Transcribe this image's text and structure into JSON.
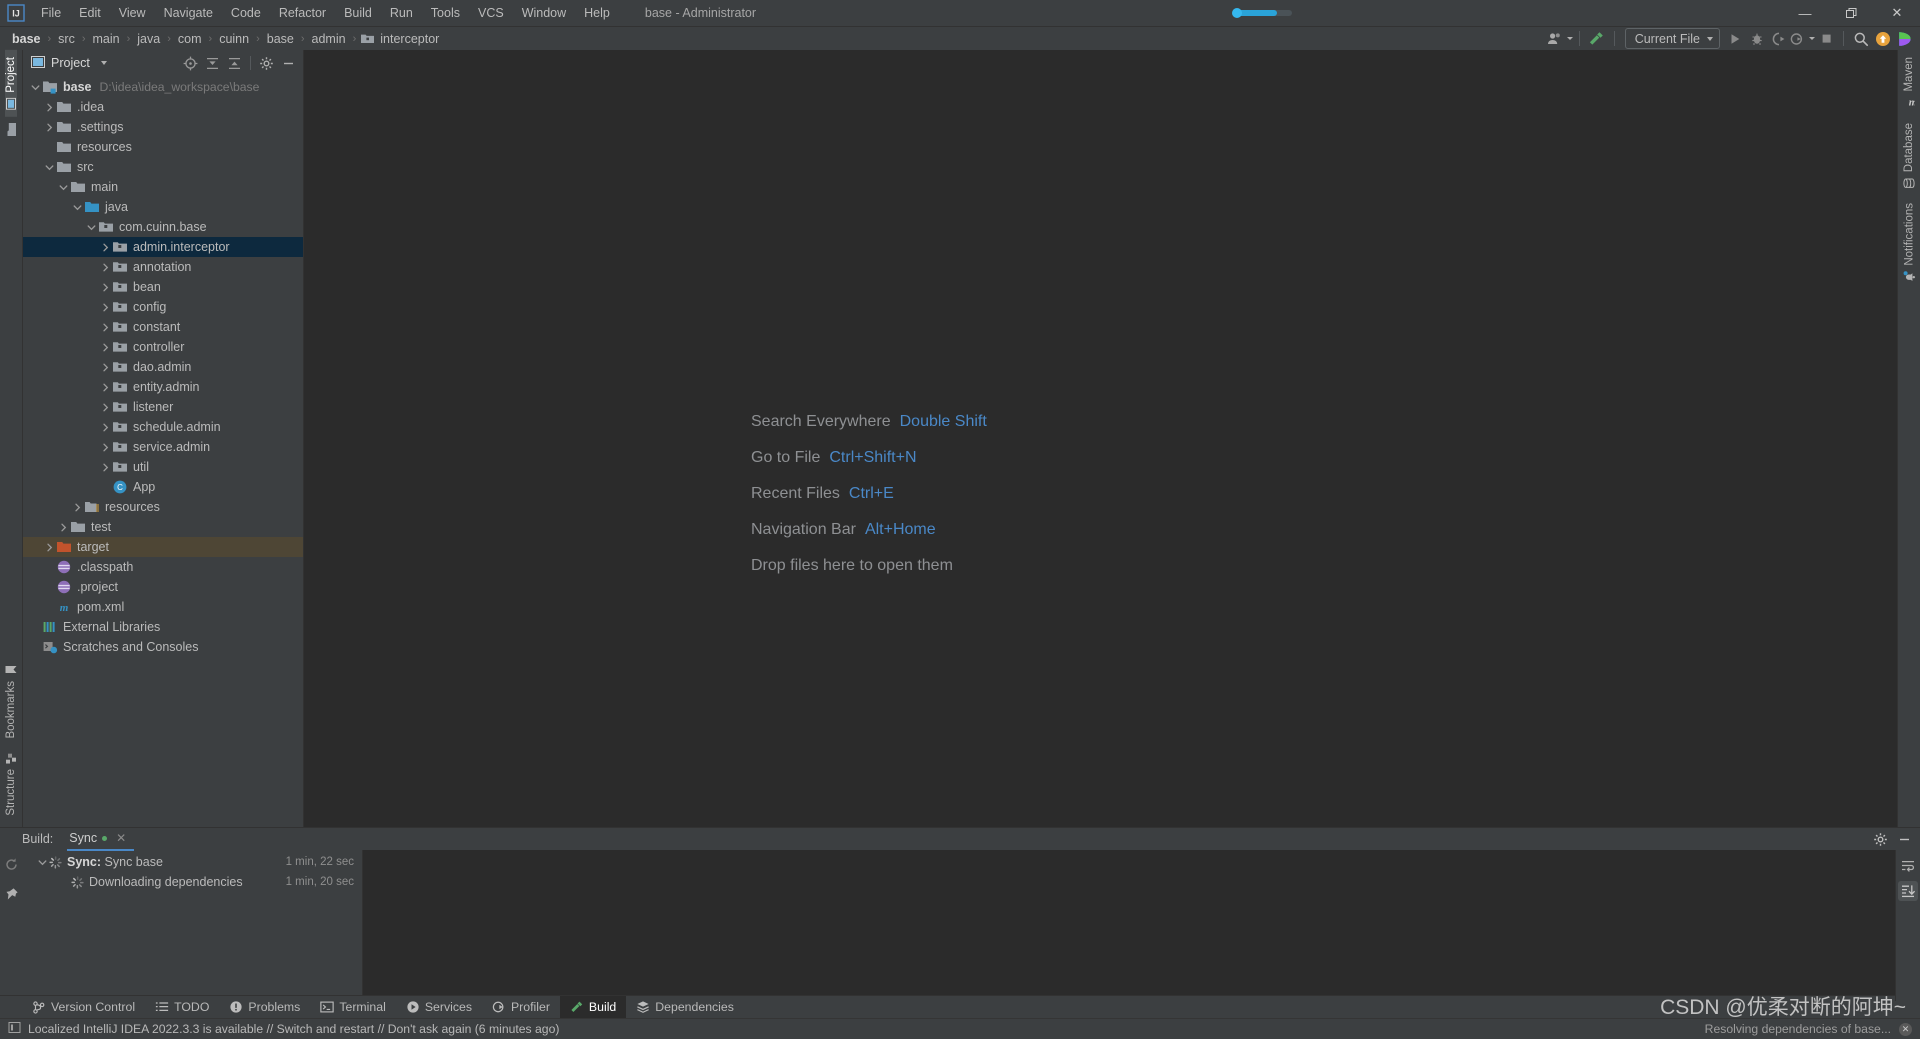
{
  "window": {
    "title": "base - Administrator",
    "logo_icon": "intellij-idea-logo",
    "minimize_label": "—",
    "maximize_label": "❐",
    "close_label": "✕"
  },
  "menu": {
    "items": [
      {
        "label": "File"
      },
      {
        "label": "Edit"
      },
      {
        "label": "View"
      },
      {
        "label": "Navigate"
      },
      {
        "label": "Code"
      },
      {
        "label": "Refactor"
      },
      {
        "label": "Build"
      },
      {
        "label": "Run"
      },
      {
        "label": "Tools"
      },
      {
        "label": "VCS"
      },
      {
        "label": "Window"
      },
      {
        "label": "Help"
      }
    ]
  },
  "navbar": {
    "crumbs": [
      {
        "label": "base",
        "icon": ""
      },
      {
        "label": "src",
        "icon": ""
      },
      {
        "label": "main",
        "icon": ""
      },
      {
        "label": "java",
        "icon": ""
      },
      {
        "label": "com",
        "icon": ""
      },
      {
        "label": "cuinn",
        "icon": ""
      },
      {
        "label": "base",
        "icon": ""
      },
      {
        "label": "admin",
        "icon": ""
      },
      {
        "label": "interceptor",
        "icon": "package-icon"
      }
    ],
    "separator": "›"
  },
  "toolbar": {
    "profile_icon": "user-profile-icon",
    "hammer_icon": "build-hammer-icon",
    "run_config": "Current File",
    "run_icon": "run-triangle-icon",
    "debug_icon": "debug-bug-icon",
    "coverage_icon": "run-with-coverage-icon",
    "profile_run_icon": "profiler-run-icon",
    "stop_icon": "stop-square-icon",
    "search_icon": "search-magnifier-icon",
    "update_icon": "update-available-icon",
    "feature_icon": "play-colored-icon"
  },
  "left_stripe": {
    "top": [
      {
        "label": "Project",
        "icon": "project-panel-icon",
        "active": true
      },
      {
        "label": "",
        "icon": "folder-icon",
        "active": false
      }
    ],
    "bottom": [
      {
        "label": "Bookmarks",
        "icon": "bookmark-icon"
      },
      {
        "label": "Structure",
        "icon": "structure-icon"
      }
    ]
  },
  "right_stripe": {
    "items": [
      {
        "label": "Maven",
        "icon": "maven-m-icon"
      },
      {
        "label": "Database",
        "icon": "database-icon"
      },
      {
        "label": "Notifications",
        "icon": "notifications-bell-icon"
      }
    ]
  },
  "project_panel": {
    "title": "Project",
    "tools": [
      {
        "name": "select-opened-file-icon"
      },
      {
        "name": "expand-all-icon"
      },
      {
        "name": "collapse-all-icon"
      },
      {
        "name": "settings-gear-icon"
      },
      {
        "name": "hide-panel-icon"
      }
    ],
    "tree": [
      {
        "depth": 0,
        "label": "base",
        "path": "D:\\idea\\idea_workspace\\base",
        "icon": "module-icon",
        "arrow": "down",
        "bold": true,
        "state": ""
      },
      {
        "depth": 1,
        "label": ".idea",
        "path": "",
        "icon": "folder-icon",
        "arrow": "right",
        "bold": false,
        "state": ""
      },
      {
        "depth": 1,
        "label": ".settings",
        "path": "",
        "icon": "folder-icon",
        "arrow": "right",
        "bold": false,
        "state": ""
      },
      {
        "depth": 1,
        "label": "resources",
        "path": "",
        "icon": "folder-icon",
        "arrow": "none",
        "bold": false,
        "state": ""
      },
      {
        "depth": 1,
        "label": "src",
        "path": "",
        "icon": "folder-icon",
        "arrow": "down",
        "bold": false,
        "state": ""
      },
      {
        "depth": 2,
        "label": "main",
        "path": "",
        "icon": "folder-icon",
        "arrow": "down",
        "bold": false,
        "state": ""
      },
      {
        "depth": 3,
        "label": "java",
        "path": "",
        "icon": "source-root-icon",
        "arrow": "down",
        "bold": false,
        "state": ""
      },
      {
        "depth": 4,
        "label": "com.cuinn.base",
        "path": "",
        "icon": "package-icon",
        "arrow": "down",
        "bold": false,
        "state": ""
      },
      {
        "depth": 5,
        "label": "admin.interceptor",
        "path": "",
        "icon": "package-icon",
        "arrow": "right",
        "bold": false,
        "state": "selected"
      },
      {
        "depth": 5,
        "label": "annotation",
        "path": "",
        "icon": "package-icon",
        "arrow": "right",
        "bold": false,
        "state": ""
      },
      {
        "depth": 5,
        "label": "bean",
        "path": "",
        "icon": "package-icon",
        "arrow": "right",
        "bold": false,
        "state": ""
      },
      {
        "depth": 5,
        "label": "config",
        "path": "",
        "icon": "package-icon",
        "arrow": "right",
        "bold": false,
        "state": ""
      },
      {
        "depth": 5,
        "label": "constant",
        "path": "",
        "icon": "package-icon",
        "arrow": "right",
        "bold": false,
        "state": ""
      },
      {
        "depth": 5,
        "label": "controller",
        "path": "",
        "icon": "package-icon",
        "arrow": "right",
        "bold": false,
        "state": ""
      },
      {
        "depth": 5,
        "label": "dao.admin",
        "path": "",
        "icon": "package-icon",
        "arrow": "right",
        "bold": false,
        "state": ""
      },
      {
        "depth": 5,
        "label": "entity.admin",
        "path": "",
        "icon": "package-icon",
        "arrow": "right",
        "bold": false,
        "state": ""
      },
      {
        "depth": 5,
        "label": "listener",
        "path": "",
        "icon": "package-icon",
        "arrow": "right",
        "bold": false,
        "state": ""
      },
      {
        "depth": 5,
        "label": "schedule.admin",
        "path": "",
        "icon": "package-icon",
        "arrow": "right",
        "bold": false,
        "state": ""
      },
      {
        "depth": 5,
        "label": "service.admin",
        "path": "",
        "icon": "package-icon",
        "arrow": "right",
        "bold": false,
        "state": ""
      },
      {
        "depth": 5,
        "label": "util",
        "path": "",
        "icon": "package-icon",
        "arrow": "right",
        "bold": false,
        "state": ""
      },
      {
        "depth": 5,
        "label": "App",
        "path": "",
        "icon": "java-class-icon",
        "arrow": "none",
        "bold": false,
        "state": ""
      },
      {
        "depth": 3,
        "label": "resources",
        "path": "",
        "icon": "resource-root-icon",
        "arrow": "right",
        "bold": false,
        "state": ""
      },
      {
        "depth": 2,
        "label": "test",
        "path": "",
        "icon": "folder-icon",
        "arrow": "right",
        "bold": false,
        "state": ""
      },
      {
        "depth": 1,
        "label": "target",
        "path": "",
        "icon": "excluded-folder-icon",
        "arrow": "right",
        "bold": false,
        "state": "highlight"
      },
      {
        "depth": 1,
        "label": ".classpath",
        "path": "",
        "icon": "eclipse-file-icon",
        "arrow": "none",
        "bold": false,
        "state": ""
      },
      {
        "depth": 1,
        "label": ".project",
        "path": "",
        "icon": "eclipse-file-icon",
        "arrow": "none",
        "bold": false,
        "state": ""
      },
      {
        "depth": 1,
        "label": "pom.xml",
        "path": "",
        "icon": "maven-pom-icon",
        "arrow": "none",
        "bold": false,
        "state": ""
      },
      {
        "depth": 0,
        "label": "External Libraries",
        "path": "",
        "icon": "libraries-icon",
        "arrow": "none",
        "bold": false,
        "state": ""
      },
      {
        "depth": 0,
        "label": "Scratches and Consoles",
        "path": "",
        "icon": "scratches-icon",
        "arrow": "none",
        "bold": false,
        "state": ""
      }
    ]
  },
  "editor": {
    "hints": [
      {
        "text": "Search Everywhere",
        "key": "Double Shift"
      },
      {
        "text": "Go to File",
        "key": "Ctrl+Shift+N"
      },
      {
        "text": "Recent Files",
        "key": "Ctrl+E"
      },
      {
        "text": "Navigation Bar",
        "key": "Alt+Home"
      },
      {
        "text": "Drop files here to open them",
        "key": ""
      }
    ]
  },
  "build_window": {
    "label": "Build:",
    "tab": "Sync",
    "tab_close": "✕",
    "gear_icon": "settings-gear-icon",
    "minimize_icon": "hide-panel-icon",
    "rerun_icon": "rerun-icon",
    "pin_icon": "pin-tab-icon",
    "side_buttons": [
      {
        "name": "soft-wrap-icon",
        "active": false
      },
      {
        "name": "scroll-to-end-icon",
        "active": true
      }
    ],
    "rows": [
      {
        "depth": 0,
        "bold_prefix": "Sync:",
        "label": "Sync base",
        "time": "1 min, 22 sec",
        "arrow": "down",
        "icon": "spinner-icon"
      },
      {
        "depth": 1,
        "bold_prefix": "",
        "label": "Downloading dependencies",
        "time": "1 min, 20 sec",
        "arrow": "none",
        "icon": "spinner-icon"
      }
    ]
  },
  "tool_window_bar": {
    "tabs": [
      {
        "label": "Version Control",
        "icon": "branch-icon",
        "active": false
      },
      {
        "label": "TODO",
        "icon": "todo-list-icon",
        "active": false
      },
      {
        "label": "Problems",
        "icon": "problems-icon",
        "active": false
      },
      {
        "label": "Terminal",
        "icon": "terminal-icon",
        "active": false
      },
      {
        "label": "Services",
        "icon": "services-icon",
        "active": false
      },
      {
        "label": "Profiler",
        "icon": "profiler-icon",
        "active": false
      },
      {
        "label": "Build",
        "icon": "build-hammer-icon",
        "active": true
      },
      {
        "label": "Dependencies",
        "icon": "dependencies-icon",
        "active": false
      }
    ]
  },
  "status_bar": {
    "icon": "ide-notification-icon",
    "message": "Localized IntelliJ IDEA 2022.3.3 is available // Switch and restart // Don't ask again (6 minutes ago)",
    "right_message": "Resolving dependencies of base...",
    "close_label": "✕"
  },
  "watermark": {
    "text": "CSDN @优柔对断的阿坤~"
  },
  "colors": {
    "accent_blue": "#4a88c7",
    "selection": "#0d293e",
    "highlight": "#4e4635",
    "panel_bg": "#3c3f41",
    "editor_bg": "#2b2b2b",
    "green": "#59a869",
    "orange": "#e8a33d"
  }
}
